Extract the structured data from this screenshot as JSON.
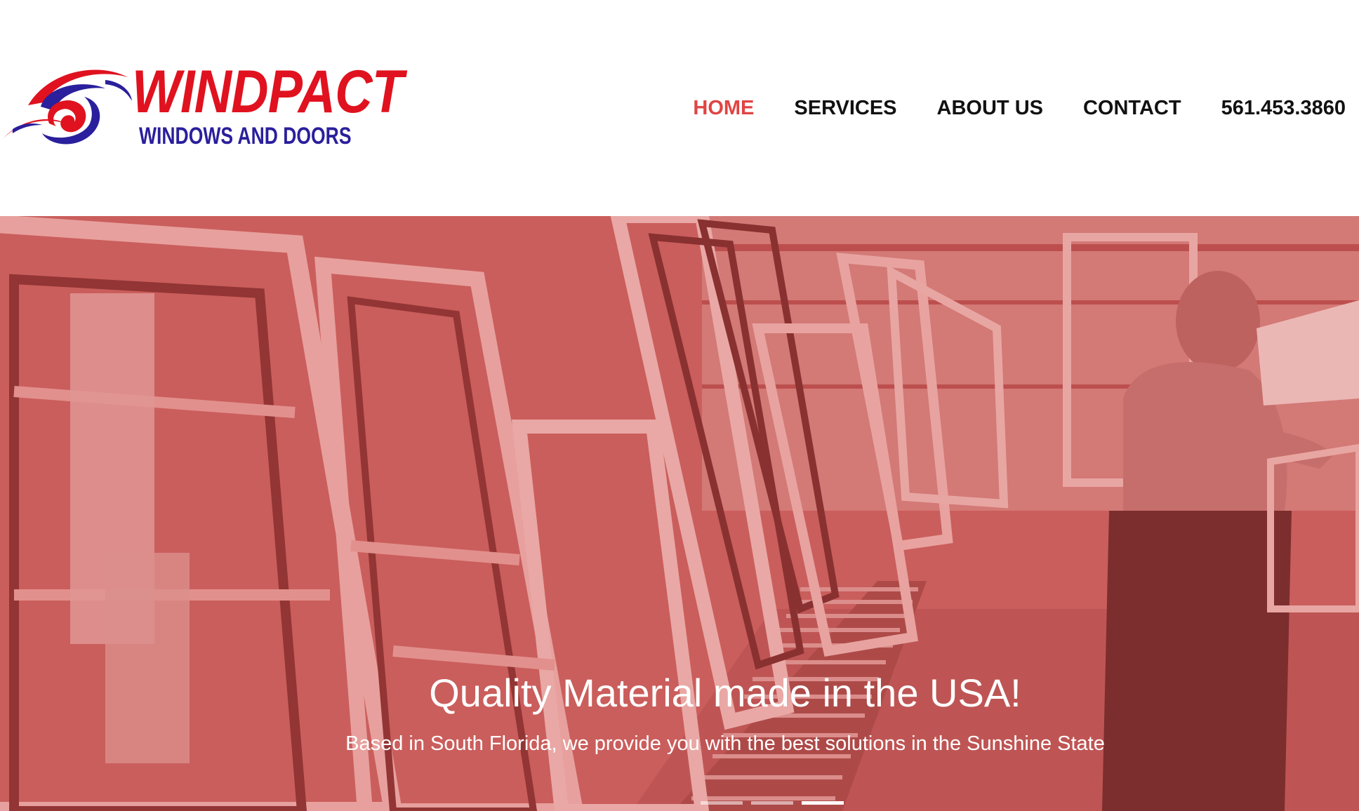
{
  "brand": {
    "name": "WINDPACT",
    "tagline": "WINDOWS AND DOORS",
    "primary_color": "#e0121f",
    "secondary_color": "#2a1f9c",
    "icon": "hurricane-swirl-icon"
  },
  "nav": {
    "items": [
      {
        "label": "HOME",
        "active": true
      },
      {
        "label": "SERVICES",
        "active": false
      },
      {
        "label": "ABOUT US",
        "active": false
      },
      {
        "label": "CONTACT",
        "active": false
      }
    ],
    "phone": "561.453.3860",
    "active_color": "#e04444"
  },
  "hero": {
    "title": "Quality Material made in the USA!",
    "subtitle": "Based in South Florida, we provide you with the best solutions in the Sunshine State",
    "overlay_color": "#c4605e",
    "slides": {
      "count": 3,
      "active_index": 2
    }
  }
}
